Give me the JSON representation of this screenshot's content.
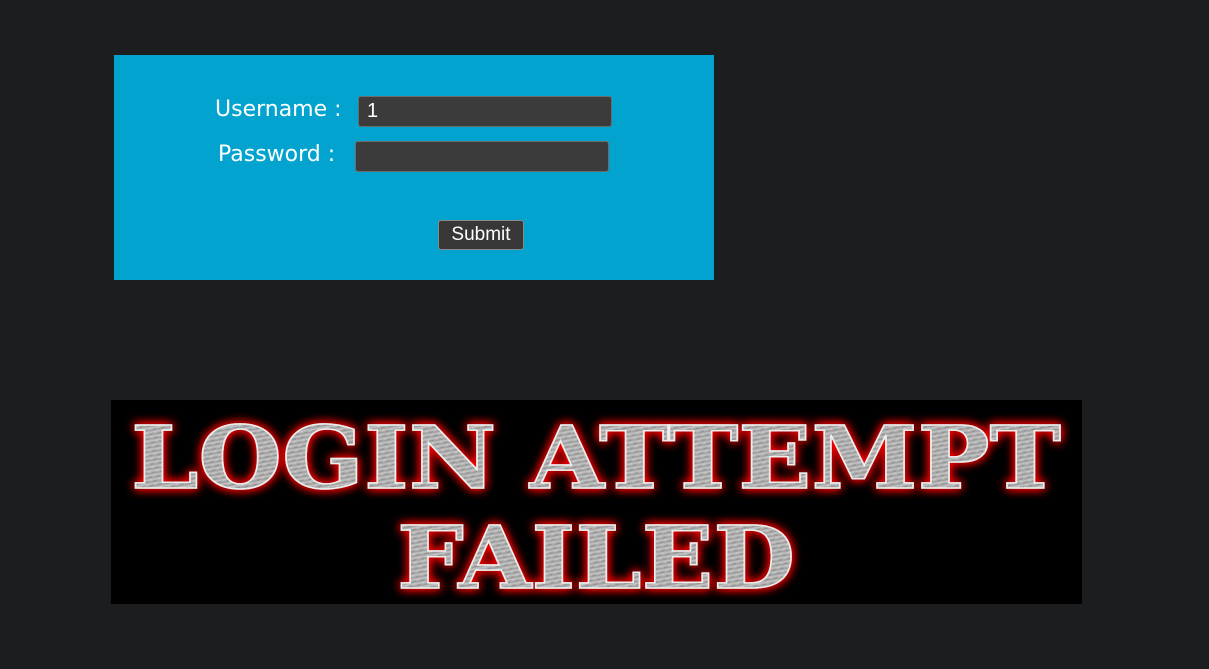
{
  "login_form": {
    "username_label": "Username :",
    "username_value": "1",
    "password_label": "Password :",
    "password_value": "",
    "submit_label": "Submit"
  },
  "banner": {
    "line1": "LOGIN ATTEMPT",
    "line2": "FAILED",
    "glow_color": "#ff0000",
    "text_color": "#a9a9a9"
  },
  "colors": {
    "page_background": "#1c1d1f",
    "panel_background": "#02a4cf"
  }
}
